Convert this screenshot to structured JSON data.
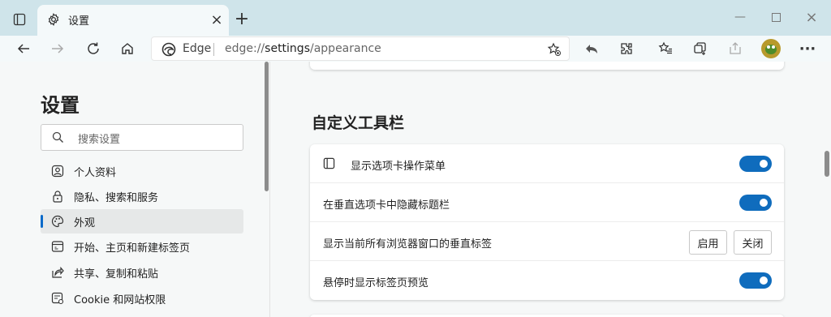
{
  "tab": {
    "title": "设置"
  },
  "address": {
    "site": "Edge",
    "url_prefix": "edge://",
    "url_path": "settings",
    "url_suffix": "/appearance"
  },
  "sidebar": {
    "title": "设置",
    "search_placeholder": "搜索设置",
    "items": [
      {
        "label": "个人资料",
        "icon": "profile-icon"
      },
      {
        "label": "隐私、搜索和服务",
        "icon": "lock-icon"
      },
      {
        "label": "外观",
        "icon": "palette-icon",
        "active": true
      },
      {
        "label": "开始、主页和新建标签页",
        "icon": "home-tab-icon"
      },
      {
        "label": "共享、复制和粘贴",
        "icon": "share-icon"
      },
      {
        "label": "Cookie 和网站权限",
        "icon": "site-permissions-icon"
      }
    ]
  },
  "main": {
    "section_title": "自定义工具栏",
    "rows": [
      {
        "label": "显示选项卡操作菜单",
        "control": "toggle",
        "on": true
      },
      {
        "label": "在垂直选项卡中隐藏标题栏",
        "control": "toggle",
        "on": true
      },
      {
        "label": "显示当前所有浏览器窗口的垂直标签",
        "control": "buttons",
        "buttons": [
          "启用",
          "关闭"
        ]
      },
      {
        "label": "悬停时显示标签页预览",
        "control": "toggle",
        "on": true
      }
    ]
  },
  "colors": {
    "accent": "#0f6cbd",
    "titlebar": "#cfe4ea",
    "toolbar": "#f4f9fa"
  }
}
